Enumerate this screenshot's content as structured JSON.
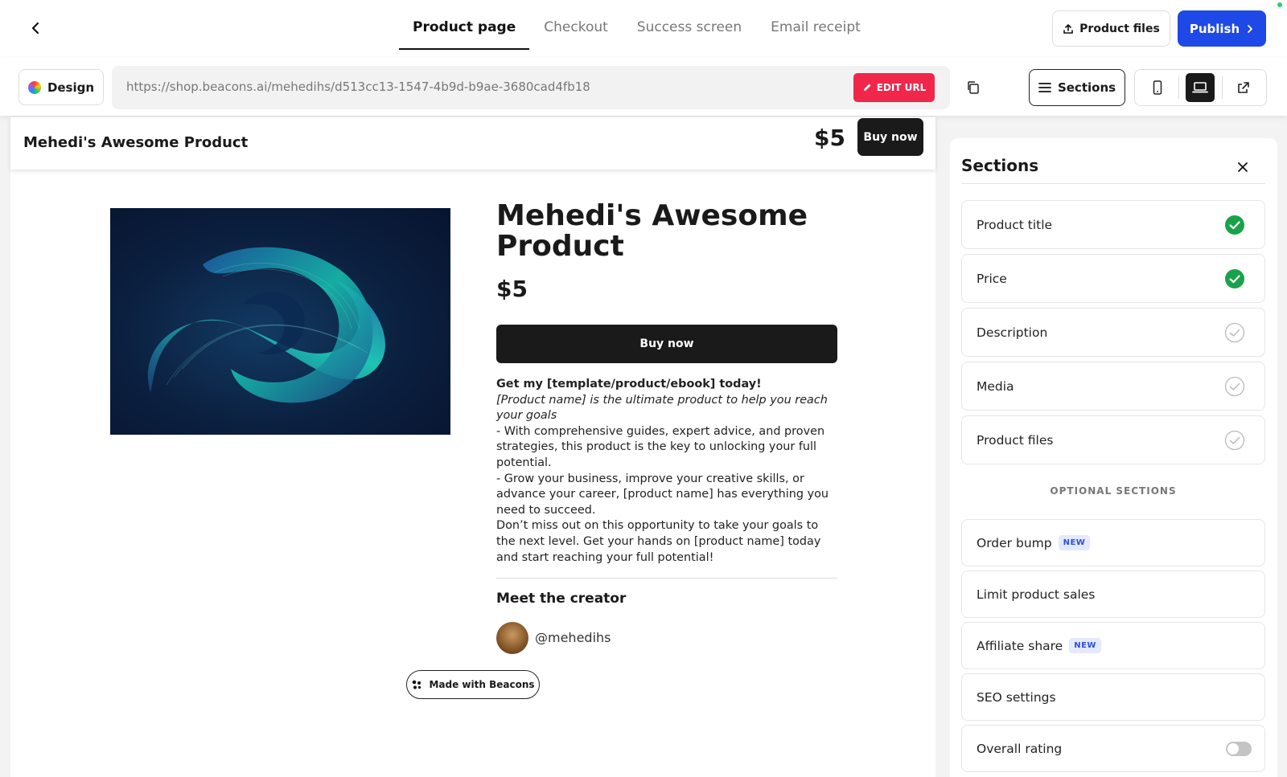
{
  "header": {
    "tabs": [
      {
        "label": "Product page",
        "active": true
      },
      {
        "label": "Checkout",
        "active": false
      },
      {
        "label": "Success screen",
        "active": false
      },
      {
        "label": "Email receipt",
        "active": false
      }
    ],
    "product_files_label": "Product files",
    "publish_label": "Publish"
  },
  "toolbar": {
    "design_label": "Design",
    "url": "https://shop.beacons.ai/mehedihs/d513cc13-1547-4b9d-b9ae-3680cad4fb18",
    "edit_url_label": "EDIT URL",
    "sections_label": "Sections"
  },
  "preview": {
    "sticky_title": "Mehedi's Awesome Product",
    "sticky_price": "$5",
    "sticky_buy_label": "Buy now",
    "title": "Mehedi's Awesome Product",
    "price": "$5",
    "buy_label": "Buy now",
    "description": {
      "heading": "Get my [template/product/ebook] today!",
      "intro": "[Product name] is the ultimate product to help you reach your goals",
      "point1": "- With comprehensive guides, expert advice, and proven strategies, this product is the key to unlocking your full potential.",
      "point2": "- Grow your business, improve your creative skills, or advance your career, [product name] has everything you need to succeed.",
      "closing": "Don’t miss out on this opportunity to take your goals to the next level. Get your hands on [product name] today and start reaching your full potential!"
    },
    "meet_creator_label": "Meet the creator",
    "creator_handle": "@mehedihs",
    "made_with_label": "Made with Beacons"
  },
  "panel": {
    "title": "Sections",
    "sections": [
      {
        "label": "Product title",
        "enabled": true
      },
      {
        "label": "Price",
        "enabled": true
      },
      {
        "label": "Description",
        "enabled": false
      },
      {
        "label": "Media",
        "enabled": false
      },
      {
        "label": "Product files",
        "enabled": false
      }
    ],
    "optional_header": "OPTIONAL SECTIONS",
    "optional": [
      {
        "label": "Order bump",
        "badge": "NEW"
      },
      {
        "label": "Limit product sales"
      },
      {
        "label": "Affiliate share",
        "badge": "NEW"
      },
      {
        "label": "SEO settings"
      },
      {
        "label": "Overall rating",
        "toggle": false
      }
    ]
  },
  "colors": {
    "publish": "#1f49e6",
    "edit_url": "#f0264a",
    "check_green": "#18a34a",
    "badge_bg": "#e4e9ff",
    "badge_text": "#2f4fd6"
  }
}
